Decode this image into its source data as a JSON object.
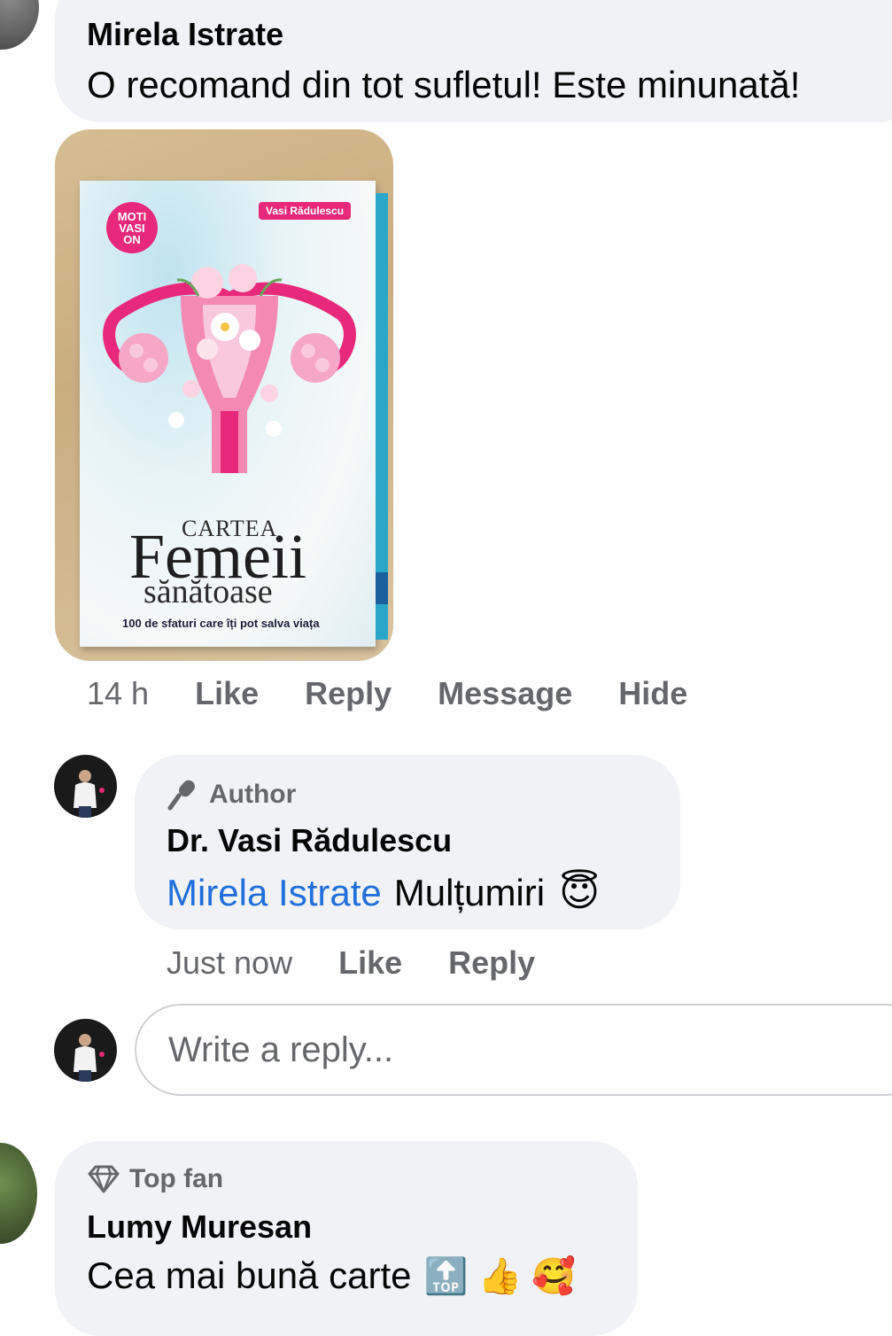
{
  "comment1": {
    "author": "Mirela Istrate",
    "text": "O recomand din tot sufletul! Este minunată!",
    "time": "14 h",
    "actions": [
      "Like",
      "Reply",
      "Message",
      "Hide"
    ],
    "book": {
      "author_tag": "Vasi Rădulescu",
      "logo": "MOTI VASI ON",
      "title_top": "CARTEA",
      "title_main": "Femeii",
      "title_sub": "sănătoase",
      "tagline": "100 de sfaturi care îți pot salva viața"
    }
  },
  "reply1": {
    "badge": "Author",
    "badge_icon": "microphone-icon",
    "author": "Dr. Vasi Rădulescu",
    "mention": "Mirela Istrate",
    "text": "Mulțumiri",
    "emoji": "😇",
    "time": "Just now",
    "actions": [
      "Like",
      "Reply"
    ]
  },
  "reply_box": {
    "placeholder": "Write a reply..."
  },
  "comment2": {
    "badge": "Top fan",
    "badge_icon": "diamond-icon",
    "author": "Lumy Muresan",
    "text": "Cea mai bună carte",
    "emojis": "🔝 👍 🥰"
  },
  "colors": {
    "bubble": "#f0f2f5",
    "text": "#050505",
    "muted": "#65676b",
    "mention": "#216fdb",
    "accent_pink": "#e8287a"
  }
}
